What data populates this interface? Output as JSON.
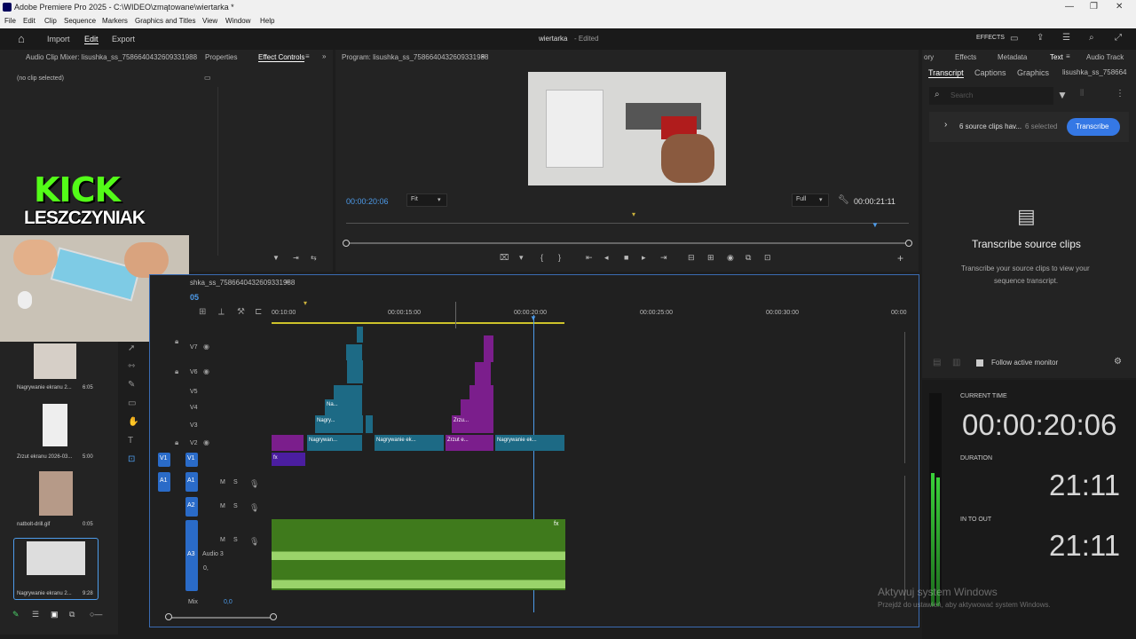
{
  "titlebar": {
    "title": "Adobe Premiere Pro 2025 - C:\\WIDEO\\zmątowane\\wiertarka *"
  },
  "menu": [
    "File",
    "Edit",
    "Clip",
    "Sequence",
    "Markers",
    "Graphics and Titles",
    "View",
    "Window",
    "Help"
  ],
  "appbar": {
    "import": "Import",
    "edit": "Edit",
    "export": "Export",
    "project": "wiertarka",
    "status": "- Edited",
    "effects": "EFFECTS"
  },
  "left_panel": {
    "tab1": "Audio Clip Mixer: lisushka_ss_7586640432609331988",
    "tab2": "Properties",
    "tab3": "Effect Controls",
    "no_clip": "(no clip selected)"
  },
  "overlay": {
    "kick": "KICK",
    "name": "LESZCZYNIAK"
  },
  "program": {
    "title": "Program: lisushka_ss_7586640432609331988",
    "tc": "00:00:20:06",
    "fit": "Fit",
    "full": "Full",
    "dur": "00:00:21:11"
  },
  "right_tabs": {
    "t0": "ory",
    "t1": "Effects",
    "t2": "Metadata",
    "t3": "Text",
    "t4": "Audio Track",
    "sub1": "Transcript",
    "sub2": "Captions",
    "sub3": "Graphics",
    "sub4": "lisushka_ss_758664"
  },
  "transcript": {
    "search": "Search",
    "clips": "6 source clips hav...",
    "selected": "6 selected",
    "btn": "Transcribe",
    "head": "Transcribe source clips",
    "desc1": "Transcribe your source clips to view your",
    "desc2": "sequence transcript.",
    "follow": "Follow active monitor"
  },
  "time": {
    "cur_lbl": "CURRENT TIME",
    "cur": "00:00:20:06",
    "dur_lbl": "DURATION",
    "dur": "21:11",
    "io_lbl": "IN TO OUT",
    "io": "21:11"
  },
  "sequence": {
    "title": "shka_ss_7586640432609331988",
    "tc": "05",
    "r1": "00:10:00",
    "r2": "00:00:15:00",
    "r3": "00:00:20:00",
    "r4": "00:00:25:00",
    "r5": "00:00:30:00",
    "r6": "00:00"
  },
  "tracks": {
    "v7": "V7",
    "v6": "V6",
    "v5": "V5",
    "v4": "V4",
    "v3": "V3",
    "v2": "V2",
    "v1": "V1",
    "a1": "A1",
    "a2": "A2",
    "a3": "A3",
    "audio3": "Audio 3",
    "mix": "Mix",
    "mixval": "0,0",
    "m": "M",
    "s": "S",
    "zero": "0,"
  },
  "clips": {
    "c1": "Nagrywan...",
    "c2": "Nagrywanie ek...",
    "c3": "Zrzut e...",
    "c4": "Nagrywanie ek...",
    "c5": "Nagry...",
    "c6": "Na...",
    "c7": "Zrzu...",
    "fx": "fx"
  },
  "project_items": [
    {
      "name": "Nagrywanie ekranu 2...",
      "dur": "6:05"
    },
    {
      "name": "Zrzut ekranu 2026-03...",
      "dur": "5:00"
    },
    {
      "name": "natbolt-drill.gif",
      "dur": "0:05"
    },
    {
      "name": "Nagrywanie ekranu 2...",
      "dur": "9:28"
    }
  ],
  "windows": {
    "line1": "Aktywuj system Windows",
    "line2": "Przejdź do ustawień, aby aktywować system Windows."
  },
  "colors": {
    "accent": "#4d9bea",
    "teal": "#1d6a85",
    "purple": "#7b1e8c",
    "green": "#3f7a1c",
    "kick": "#53fc18"
  }
}
